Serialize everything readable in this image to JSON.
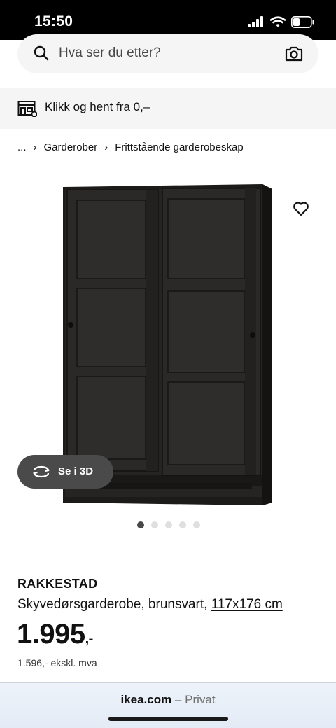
{
  "status_bar": {
    "time": "15:50"
  },
  "search": {
    "placeholder": "Hva ser du etter?"
  },
  "pickup_banner": {
    "label": "Klikk og hent fra 0,–"
  },
  "breadcrumb": {
    "ellipsis": "...",
    "items": [
      "Garderober",
      "Frittstående garderobeskap"
    ]
  },
  "gallery": {
    "view_3d_label": "Se i 3D",
    "image_count": 5,
    "active_index": 0
  },
  "product": {
    "name": "RAKKESTAD",
    "description": "Skyvedørsgarderobe, brunsvart,",
    "size": "117x176 cm",
    "price": "1.995",
    "price_suffix": ",-",
    "price_excl_vat": "1.596,- ekskl. mva"
  },
  "browser": {
    "domain": "ikea.com",
    "mode": " – Privat"
  },
  "colors": {
    "product": "#2b2927",
    "pill": "#4a4a4a",
    "banner_bg": "#f5f5f5"
  }
}
